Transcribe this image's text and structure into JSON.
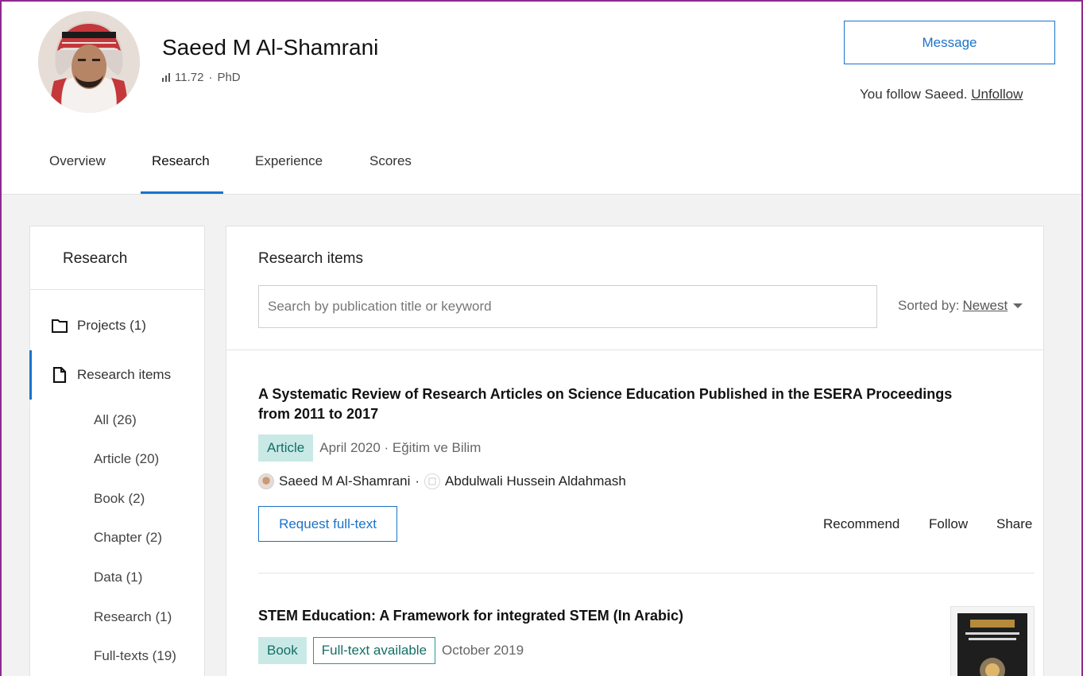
{
  "profile": {
    "name": "Saeed M Al-Shamrani",
    "score": "11.72",
    "separator": "·",
    "degree": "PhD",
    "message_label": "Message",
    "follow_text": "You follow Saeed.",
    "unfollow_label": "Unfollow"
  },
  "tabs": [
    {
      "label": "Overview"
    },
    {
      "label": "Research",
      "active": true
    },
    {
      "label": "Experience"
    },
    {
      "label": "Scores"
    }
  ],
  "sidebar": {
    "title": "Research",
    "projects_label": "Projects (1)",
    "research_items_label": "Research items",
    "sub_items": [
      {
        "label": "All (26)"
      },
      {
        "label": "Article (20)"
      },
      {
        "label": "Book (2)"
      },
      {
        "label": "Chapter (2)"
      },
      {
        "label": "Data (1)"
      },
      {
        "label": "Research (1)"
      },
      {
        "label": "Full-texts (19)"
      }
    ]
  },
  "main": {
    "title": "Research items",
    "search_placeholder": "Search by publication title or keyword",
    "sort_label": "Sorted by:",
    "sort_value": "Newest",
    "items": [
      {
        "title_line1": "A Systematic Review of Research Articles on Science Education Published in the ESERA Proceedings",
        "title_line2": "from 2011 to 2017",
        "type": "Article",
        "meta": "April 2020 · Eğitim ve Bilim",
        "author1": "Saeed M Al-Shamrani",
        "author_sep": "·",
        "author2": "Abdulwali Hussein Aldahmash",
        "request_label": "Request full-text",
        "recommend_label": "Recommend",
        "follow_label": "Follow",
        "share_label": "Share"
      },
      {
        "title": "STEM Education: A Framework for integrated STEM (In Arabic)",
        "type": "Book",
        "fulltext_badge": "Full-text available",
        "meta": "October 2019"
      }
    ]
  },
  "colors": {
    "accent": "#1a73c9",
    "badge_bg": "#c9e9e6",
    "badge_text": "#136f66",
    "frame": "#8e2a8f"
  }
}
